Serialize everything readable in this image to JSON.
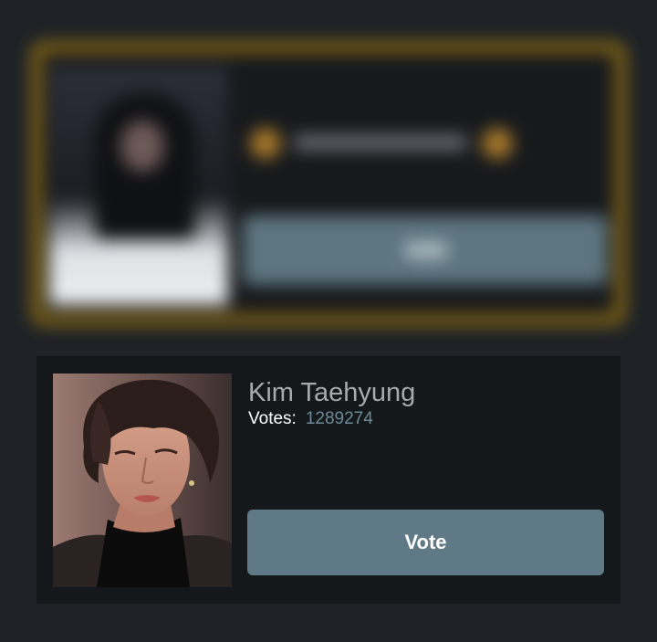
{
  "candidate": {
    "name": "Kim Taehyung",
    "votes_label": "Votes:",
    "votes_value": "1289274",
    "vote_button_label": "Vote",
    "photo_icon": "portrait-photo"
  },
  "colors": {
    "background": "#1f2226",
    "card_background": "#15181b",
    "button_background": "#5f7a86",
    "votes_value": "#6c8a97",
    "blurred_card_border": "#8a6a14"
  }
}
